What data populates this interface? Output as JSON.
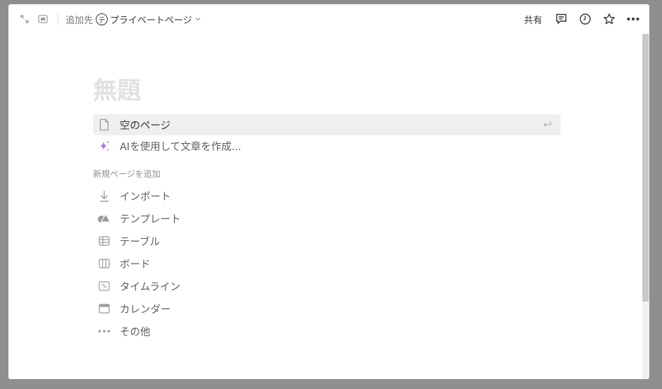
{
  "topbar": {
    "add_to_label": "追加先",
    "workspace_initial": "テ",
    "workspace_name": "プライベートページ",
    "share_label": "共有",
    "icons": [
      "expand-icon",
      "sidebar-peek-icon",
      "comment-icon",
      "clock-icon",
      "star-icon",
      "more-icon"
    ]
  },
  "page": {
    "title": "無題"
  },
  "suggestions": [
    {
      "label": "空のページ",
      "icon": "page-icon"
    },
    {
      "label": "AIを使用して文章を作成...",
      "icon": "sparkle-icon"
    }
  ],
  "new_page_section": {
    "label": "新規ページを追加",
    "items": [
      {
        "label": "インポート",
        "icon": "download-icon"
      },
      {
        "label": "テンプレート",
        "icon": "shapes-icon"
      },
      {
        "label": "テーブル",
        "icon": "table-icon"
      },
      {
        "label": "ボード",
        "icon": "board-icon"
      },
      {
        "label": "タイムライン",
        "icon": "timeline-icon"
      },
      {
        "label": "カレンダー",
        "icon": "calendar-icon"
      },
      {
        "label": "その他",
        "icon": "more-dots-icon"
      }
    ]
  },
  "colors": {
    "ai_accent": "#a77fd6",
    "text_muted": "#9b9a97",
    "highlight_row": "#efefee"
  }
}
